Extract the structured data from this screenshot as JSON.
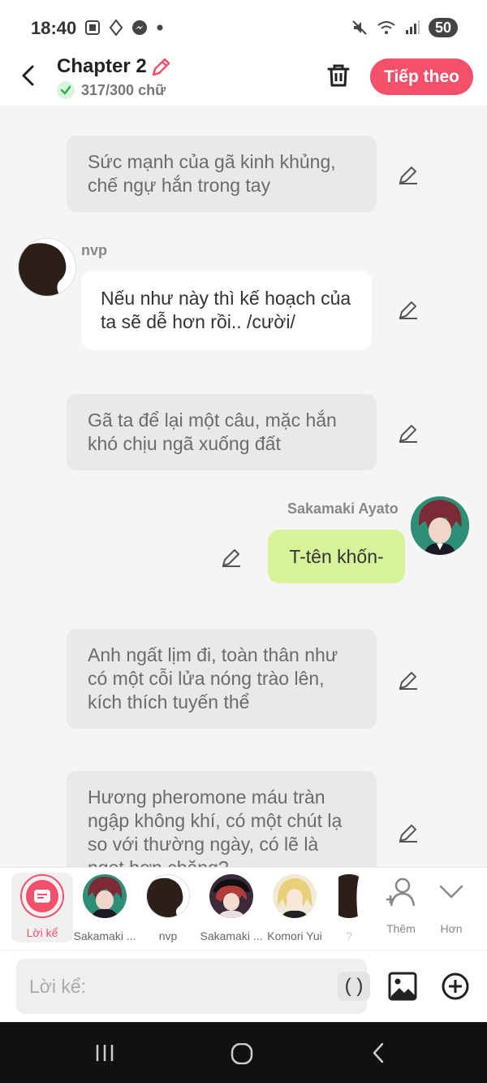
{
  "status_bar": {
    "time": "18:40",
    "battery": "50"
  },
  "header": {
    "title": "Chapter 2",
    "word_count": "317/300 chữ",
    "next_label": "Tiếp theo"
  },
  "messages": {
    "m1": "Sức mạnh của gã kinh khủng, chế ngự hắn trong tay",
    "m2_speaker": "nvp",
    "m2": "Nếu như này thì kế hoạch của ta sẽ dễ hơn rồi.. /cười/",
    "m3": "Gã ta để lại một câu, mặc hắn khó chịu ngã xuống đất",
    "m4_speaker": "Sakamaki Ayato",
    "m4": "T-tên khốn-",
    "m5": "Anh ngất lịm đi, toàn thân như có một cỗi lửa nóng trào lên, kích thích tuyến thể",
    "m6": "Hương pheromone máu tràn ngập không khí, có một chút lạ so với thường ngày, có lẽ là ngọt hơn chăng?"
  },
  "characters": {
    "narrator": "Lời kể",
    "c1": "Sakamaki ...",
    "c2": "nvp",
    "c3": "Sakamaki ...",
    "c4": "Komori Yui",
    "c5": "?"
  },
  "tools": {
    "more": "Thêm",
    "less": "Hơn"
  },
  "input": {
    "placeholder": "Lời kể:",
    "paren": "( )"
  },
  "colors": {
    "accent": "#f3516b",
    "green_bubble": "#d7f39a"
  }
}
